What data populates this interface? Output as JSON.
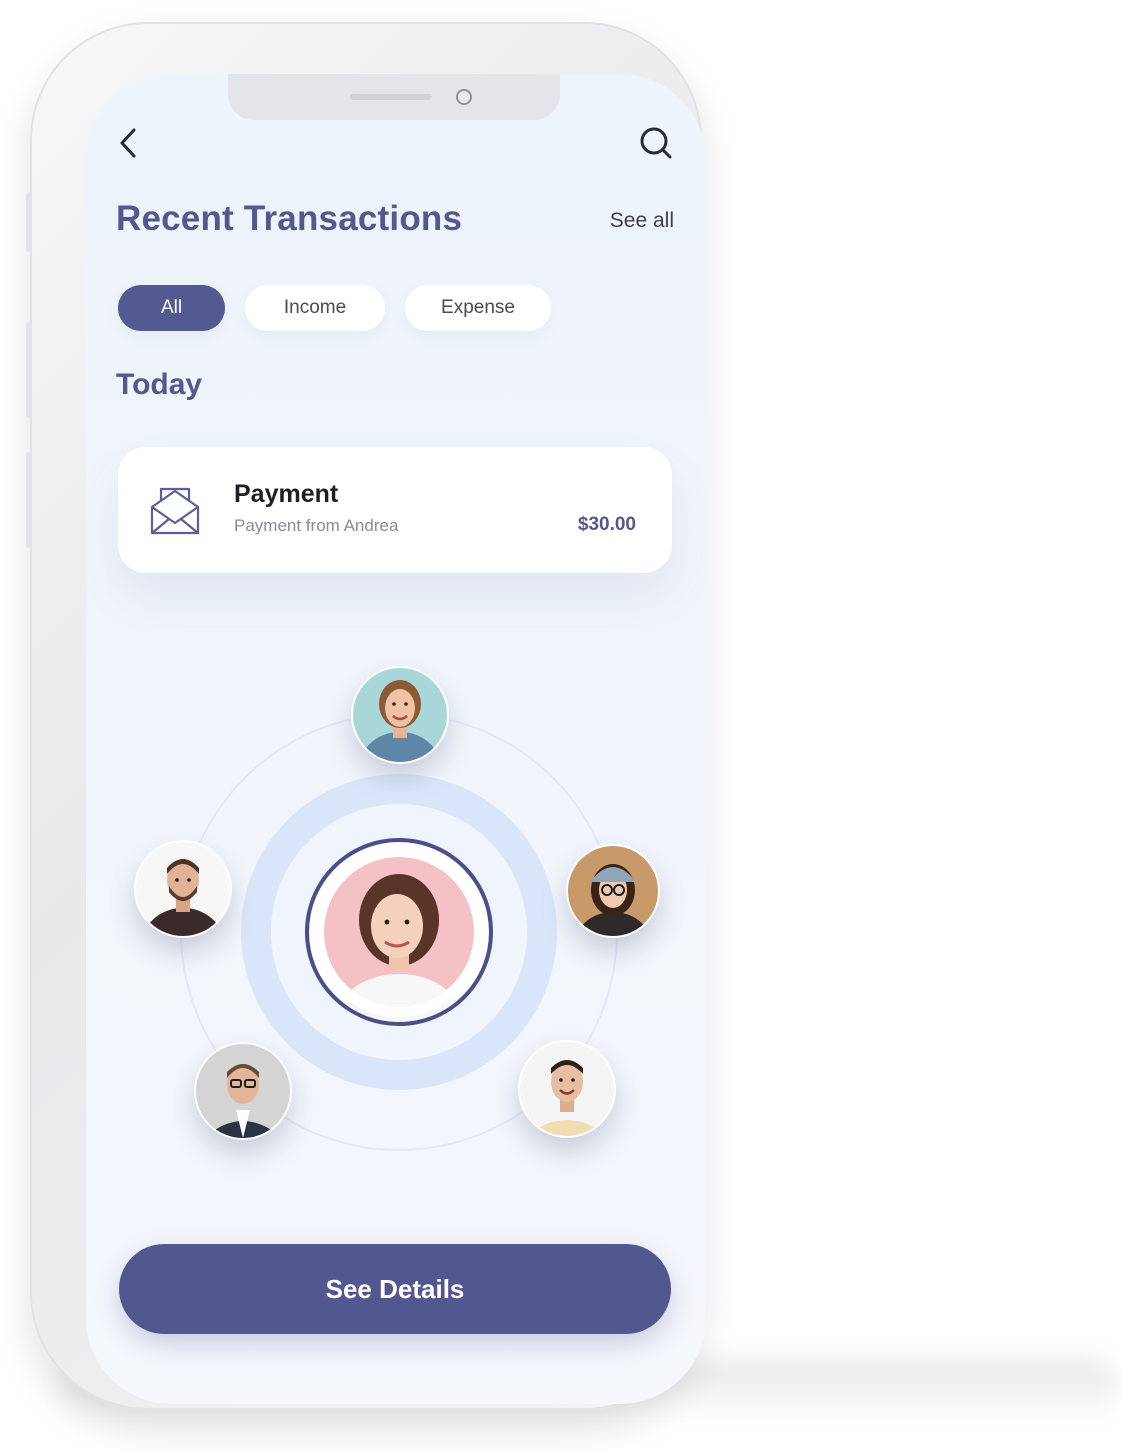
{
  "header": {
    "back_icon": "chevron-left-icon",
    "search_icon": "search-icon"
  },
  "title": "Recent Transactions",
  "see_all_label": "See all",
  "filters": [
    {
      "label": "All",
      "active": true
    },
    {
      "label": "Income",
      "active": false
    },
    {
      "label": "Expense",
      "active": false
    }
  ],
  "section_label": "Today",
  "transaction": {
    "icon": "envelope-open-icon",
    "title": "Payment",
    "subtitle": "Payment from Andrea",
    "amount": "$30.00"
  },
  "contacts": {
    "center": {
      "icon": "avatar-woman-center"
    },
    "orbit": [
      {
        "icon": "avatar-woman-top"
      },
      {
        "icon": "avatar-man-left"
      },
      {
        "icon": "avatar-woman-right"
      },
      {
        "icon": "avatar-man-bottom-left"
      },
      {
        "icon": "avatar-man-bottom-right"
      }
    ]
  },
  "cta_label": "See Details",
  "colors": {
    "accent": "#535a92",
    "title": "#55588f",
    "background": "#eef4fb"
  }
}
